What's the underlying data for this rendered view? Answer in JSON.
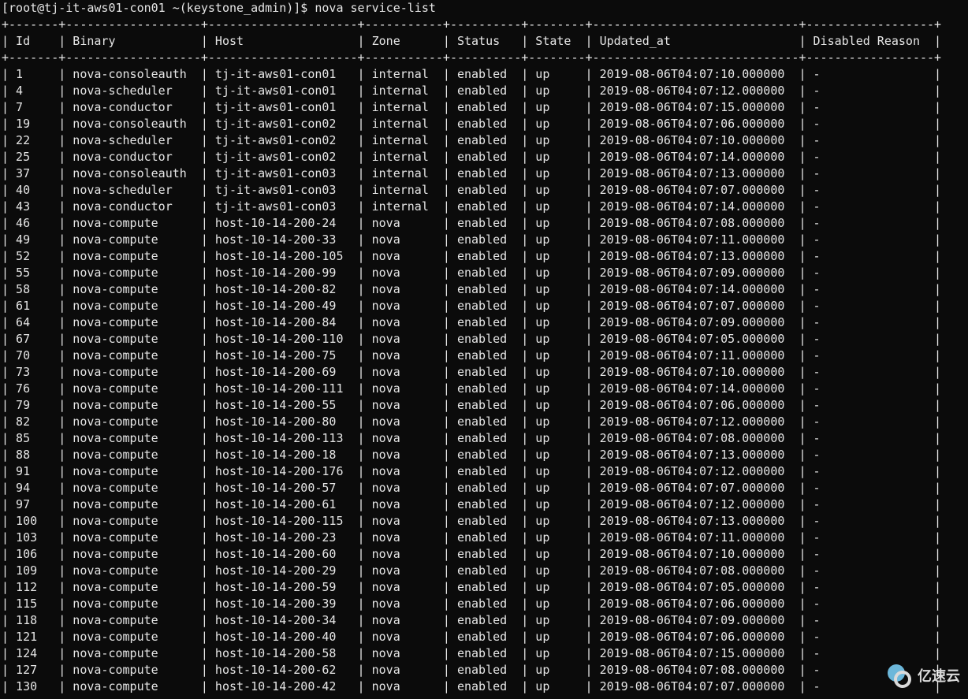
{
  "prompt": "[root@tj-it-aws01-con01 ~(keystone_admin)]$ nova service-list",
  "watermark_text": "亿速云",
  "columns": [
    {
      "key": "id",
      "label": "Id",
      "width": 5
    },
    {
      "key": "binary",
      "label": "Binary",
      "width": 17
    },
    {
      "key": "host",
      "label": "Host",
      "width": 19
    },
    {
      "key": "zone",
      "label": "Zone",
      "width": 9
    },
    {
      "key": "status",
      "label": "Status",
      "width": 8
    },
    {
      "key": "state",
      "label": "State",
      "width": 6
    },
    {
      "key": "updated",
      "label": "Updated_at",
      "width": 27
    },
    {
      "key": "disabled",
      "label": "Disabled Reason",
      "width": 16
    }
  ],
  "rows": [
    {
      "id": "1",
      "binary": "nova-consoleauth",
      "host": "tj-it-aws01-con01",
      "zone": "internal",
      "status": "enabled",
      "state": "up",
      "updated": "2019-08-06T04:07:10.000000",
      "disabled": "-"
    },
    {
      "id": "4",
      "binary": "nova-scheduler",
      "host": "tj-it-aws01-con01",
      "zone": "internal",
      "status": "enabled",
      "state": "up",
      "updated": "2019-08-06T04:07:12.000000",
      "disabled": "-"
    },
    {
      "id": "7",
      "binary": "nova-conductor",
      "host": "tj-it-aws01-con01",
      "zone": "internal",
      "status": "enabled",
      "state": "up",
      "updated": "2019-08-06T04:07:15.000000",
      "disabled": "-"
    },
    {
      "id": "19",
      "binary": "nova-consoleauth",
      "host": "tj-it-aws01-con02",
      "zone": "internal",
      "status": "enabled",
      "state": "up",
      "updated": "2019-08-06T04:07:06.000000",
      "disabled": "-"
    },
    {
      "id": "22",
      "binary": "nova-scheduler",
      "host": "tj-it-aws01-con02",
      "zone": "internal",
      "status": "enabled",
      "state": "up",
      "updated": "2019-08-06T04:07:10.000000",
      "disabled": "-"
    },
    {
      "id": "25",
      "binary": "nova-conductor",
      "host": "tj-it-aws01-con02",
      "zone": "internal",
      "status": "enabled",
      "state": "up",
      "updated": "2019-08-06T04:07:14.000000",
      "disabled": "-"
    },
    {
      "id": "37",
      "binary": "nova-consoleauth",
      "host": "tj-it-aws01-con03",
      "zone": "internal",
      "status": "enabled",
      "state": "up",
      "updated": "2019-08-06T04:07:13.000000",
      "disabled": "-"
    },
    {
      "id": "40",
      "binary": "nova-scheduler",
      "host": "tj-it-aws01-con03",
      "zone": "internal",
      "status": "enabled",
      "state": "up",
      "updated": "2019-08-06T04:07:07.000000",
      "disabled": "-"
    },
    {
      "id": "43",
      "binary": "nova-conductor",
      "host": "tj-it-aws01-con03",
      "zone": "internal",
      "status": "enabled",
      "state": "up",
      "updated": "2019-08-06T04:07:14.000000",
      "disabled": "-"
    },
    {
      "id": "46",
      "binary": "nova-compute",
      "host": "host-10-14-200-24",
      "zone": "nova",
      "status": "enabled",
      "state": "up",
      "updated": "2019-08-06T04:07:08.000000",
      "disabled": "-"
    },
    {
      "id": "49",
      "binary": "nova-compute",
      "host": "host-10-14-200-33",
      "zone": "nova",
      "status": "enabled",
      "state": "up",
      "updated": "2019-08-06T04:07:11.000000",
      "disabled": "-"
    },
    {
      "id": "52",
      "binary": "nova-compute",
      "host": "host-10-14-200-105",
      "zone": "nova",
      "status": "enabled",
      "state": "up",
      "updated": "2019-08-06T04:07:13.000000",
      "disabled": "-"
    },
    {
      "id": "55",
      "binary": "nova-compute",
      "host": "host-10-14-200-99",
      "zone": "nova",
      "status": "enabled",
      "state": "up",
      "updated": "2019-08-06T04:07:09.000000",
      "disabled": "-"
    },
    {
      "id": "58",
      "binary": "nova-compute",
      "host": "host-10-14-200-82",
      "zone": "nova",
      "status": "enabled",
      "state": "up",
      "updated": "2019-08-06T04:07:14.000000",
      "disabled": "-"
    },
    {
      "id": "61",
      "binary": "nova-compute",
      "host": "host-10-14-200-49",
      "zone": "nova",
      "status": "enabled",
      "state": "up",
      "updated": "2019-08-06T04:07:07.000000",
      "disabled": "-"
    },
    {
      "id": "64",
      "binary": "nova-compute",
      "host": "host-10-14-200-84",
      "zone": "nova",
      "status": "enabled",
      "state": "up",
      "updated": "2019-08-06T04:07:09.000000",
      "disabled": "-"
    },
    {
      "id": "67",
      "binary": "nova-compute",
      "host": "host-10-14-200-110",
      "zone": "nova",
      "status": "enabled",
      "state": "up",
      "updated": "2019-08-06T04:07:05.000000",
      "disabled": "-"
    },
    {
      "id": "70",
      "binary": "nova-compute",
      "host": "host-10-14-200-75",
      "zone": "nova",
      "status": "enabled",
      "state": "up",
      "updated": "2019-08-06T04:07:11.000000",
      "disabled": "-"
    },
    {
      "id": "73",
      "binary": "nova-compute",
      "host": "host-10-14-200-69",
      "zone": "nova",
      "status": "enabled",
      "state": "up",
      "updated": "2019-08-06T04:07:10.000000",
      "disabled": "-"
    },
    {
      "id": "76",
      "binary": "nova-compute",
      "host": "host-10-14-200-111",
      "zone": "nova",
      "status": "enabled",
      "state": "up",
      "updated": "2019-08-06T04:07:14.000000",
      "disabled": "-"
    },
    {
      "id": "79",
      "binary": "nova-compute",
      "host": "host-10-14-200-55",
      "zone": "nova",
      "status": "enabled",
      "state": "up",
      "updated": "2019-08-06T04:07:06.000000",
      "disabled": "-"
    },
    {
      "id": "82",
      "binary": "nova-compute",
      "host": "host-10-14-200-80",
      "zone": "nova",
      "status": "enabled",
      "state": "up",
      "updated": "2019-08-06T04:07:12.000000",
      "disabled": "-"
    },
    {
      "id": "85",
      "binary": "nova-compute",
      "host": "host-10-14-200-113",
      "zone": "nova",
      "status": "enabled",
      "state": "up",
      "updated": "2019-08-06T04:07:08.000000",
      "disabled": "-"
    },
    {
      "id": "88",
      "binary": "nova-compute",
      "host": "host-10-14-200-18",
      "zone": "nova",
      "status": "enabled",
      "state": "up",
      "updated": "2019-08-06T04:07:13.000000",
      "disabled": "-"
    },
    {
      "id": "91",
      "binary": "nova-compute",
      "host": "host-10-14-200-176",
      "zone": "nova",
      "status": "enabled",
      "state": "up",
      "updated": "2019-08-06T04:07:12.000000",
      "disabled": "-"
    },
    {
      "id": "94",
      "binary": "nova-compute",
      "host": "host-10-14-200-57",
      "zone": "nova",
      "status": "enabled",
      "state": "up",
      "updated": "2019-08-06T04:07:07.000000",
      "disabled": "-"
    },
    {
      "id": "97",
      "binary": "nova-compute",
      "host": "host-10-14-200-61",
      "zone": "nova",
      "status": "enabled",
      "state": "up",
      "updated": "2019-08-06T04:07:12.000000",
      "disabled": "-"
    },
    {
      "id": "100",
      "binary": "nova-compute",
      "host": "host-10-14-200-115",
      "zone": "nova",
      "status": "enabled",
      "state": "up",
      "updated": "2019-08-06T04:07:13.000000",
      "disabled": "-"
    },
    {
      "id": "103",
      "binary": "nova-compute",
      "host": "host-10-14-200-23",
      "zone": "nova",
      "status": "enabled",
      "state": "up",
      "updated": "2019-08-06T04:07:11.000000",
      "disabled": "-"
    },
    {
      "id": "106",
      "binary": "nova-compute",
      "host": "host-10-14-200-60",
      "zone": "nova",
      "status": "enabled",
      "state": "up",
      "updated": "2019-08-06T04:07:10.000000",
      "disabled": "-"
    },
    {
      "id": "109",
      "binary": "nova-compute",
      "host": "host-10-14-200-29",
      "zone": "nova",
      "status": "enabled",
      "state": "up",
      "updated": "2019-08-06T04:07:08.000000",
      "disabled": "-"
    },
    {
      "id": "112",
      "binary": "nova-compute",
      "host": "host-10-14-200-59",
      "zone": "nova",
      "status": "enabled",
      "state": "up",
      "updated": "2019-08-06T04:07:05.000000",
      "disabled": "-"
    },
    {
      "id": "115",
      "binary": "nova-compute",
      "host": "host-10-14-200-39",
      "zone": "nova",
      "status": "enabled",
      "state": "up",
      "updated": "2019-08-06T04:07:06.000000",
      "disabled": "-"
    },
    {
      "id": "118",
      "binary": "nova-compute",
      "host": "host-10-14-200-34",
      "zone": "nova",
      "status": "enabled",
      "state": "up",
      "updated": "2019-08-06T04:07:09.000000",
      "disabled": "-"
    },
    {
      "id": "121",
      "binary": "nova-compute",
      "host": "host-10-14-200-40",
      "zone": "nova",
      "status": "enabled",
      "state": "up",
      "updated": "2019-08-06T04:07:06.000000",
      "disabled": "-"
    },
    {
      "id": "124",
      "binary": "nova-compute",
      "host": "host-10-14-200-58",
      "zone": "nova",
      "status": "enabled",
      "state": "up",
      "updated": "2019-08-06T04:07:15.000000",
      "disabled": "-"
    },
    {
      "id": "127",
      "binary": "nova-compute",
      "host": "host-10-14-200-62",
      "zone": "nova",
      "status": "enabled",
      "state": "up",
      "updated": "2019-08-06T04:07:08.000000",
      "disabled": "-"
    },
    {
      "id": "130",
      "binary": "nova-compute",
      "host": "host-10-14-200-42",
      "zone": "nova",
      "status": "enabled",
      "state": "up",
      "updated": "2019-08-06T04:07:07.000000",
      "disabled": "-"
    }
  ]
}
